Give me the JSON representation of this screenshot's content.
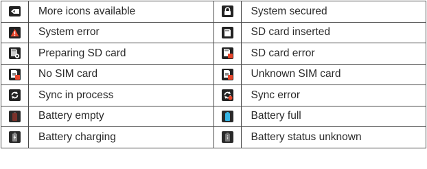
{
  "rows": [
    {
      "left": {
        "icon": "more-icons-icon",
        "label": "More icons available"
      },
      "right": {
        "icon": "lock-icon",
        "label": "System secured"
      }
    },
    {
      "left": {
        "icon": "warning-icon",
        "label": "System error"
      },
      "right": {
        "icon": "sd-card-icon",
        "label": "SD card inserted"
      }
    },
    {
      "left": {
        "icon": "sd-card-preparing-icon",
        "label": "Preparing SD card"
      },
      "right": {
        "icon": "sd-card-error-icon",
        "label": "SD card error"
      }
    },
    {
      "left": {
        "icon": "no-sim-icon",
        "label": "No SIM card"
      },
      "right": {
        "icon": "unknown-sim-icon",
        "label": "Unknown SIM card"
      }
    },
    {
      "left": {
        "icon": "sync-icon",
        "label": "Sync in process"
      },
      "right": {
        "icon": "sync-error-icon",
        "label": "Sync error"
      }
    },
    {
      "left": {
        "icon": "battery-empty-icon",
        "label": "Battery empty"
      },
      "right": {
        "icon": "battery-full-icon",
        "label": "Battery full"
      }
    },
    {
      "left": {
        "icon": "battery-charging-icon",
        "label": "Battery charging"
      },
      "right": {
        "icon": "battery-unknown-icon",
        "label": "Battery status unknown"
      }
    }
  ],
  "colors": {
    "icon_background": "#222222",
    "error_accent": "#e8452a",
    "battery_full": "#35b6e6",
    "battery_empty": "#c0392b",
    "battery_charging": "#6fae3a"
  }
}
